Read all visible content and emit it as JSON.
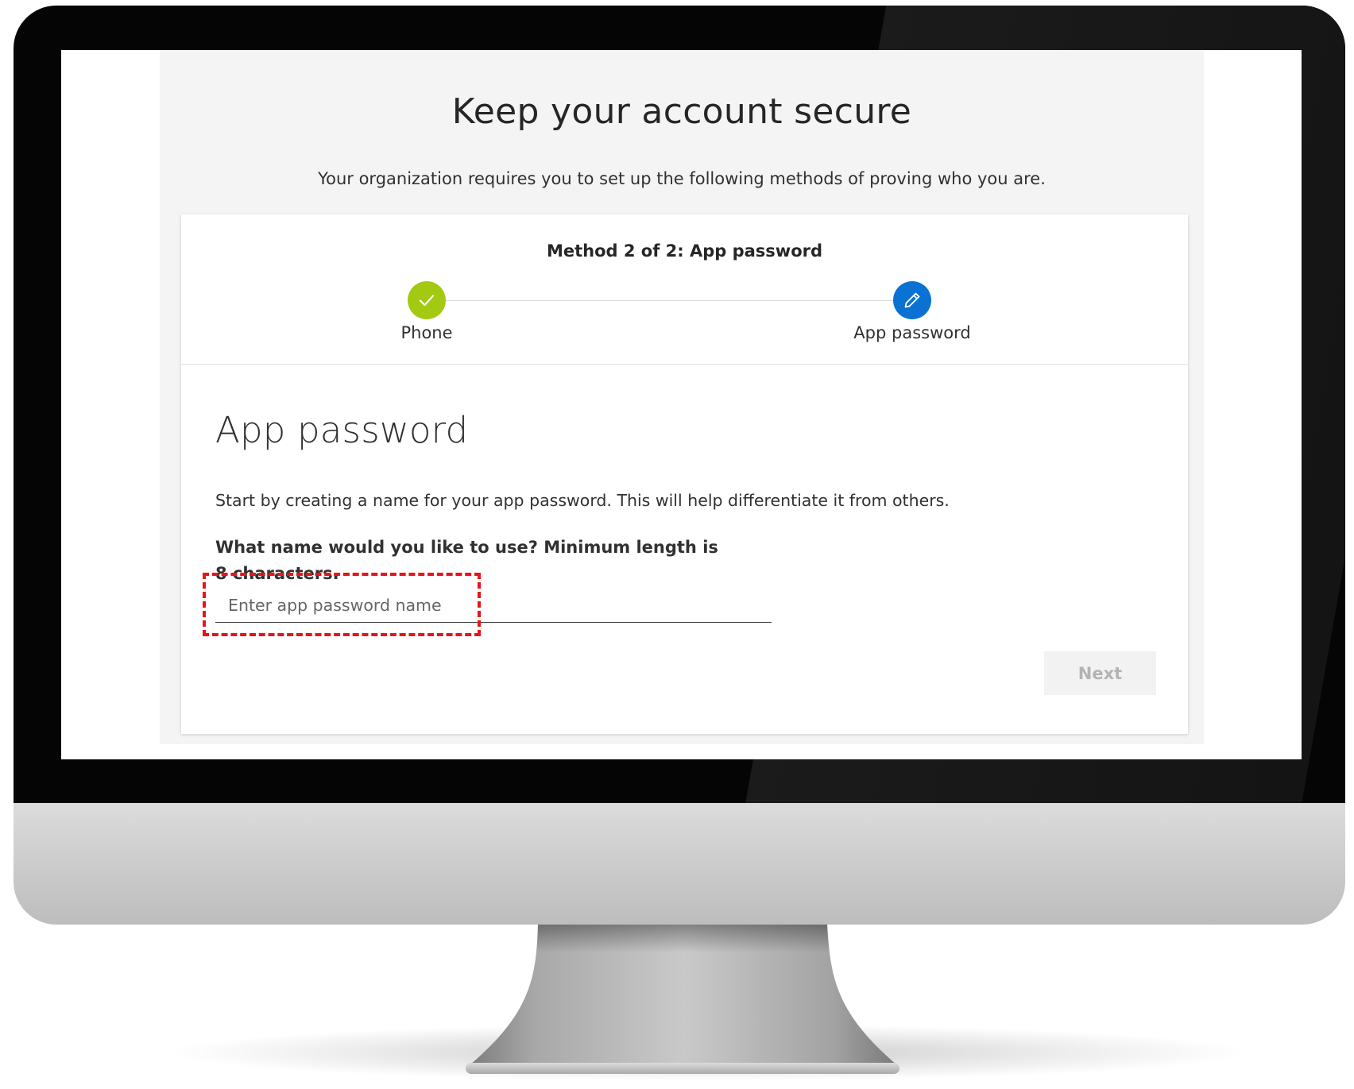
{
  "page": {
    "title": "Keep your account secure",
    "subtitle": "Your organization requires you to set up the following methods of proving who you are."
  },
  "wizard": {
    "method_heading": "Method 2 of 2: App password",
    "steps": [
      {
        "label": "Phone",
        "state": "completed",
        "icon": "checkmark-icon",
        "color": "#a4c912"
      },
      {
        "label": "App password",
        "state": "current",
        "icon": "pencil-icon",
        "color": "#0b72d4"
      }
    ]
  },
  "form": {
    "section_title": "App password",
    "description": "Start by creating a name for your app password. This will help differentiate it from others.",
    "field_label": "What name would you like to use? Minimum length is 8 characters.",
    "input_value": "",
    "input_placeholder": "Enter app password name",
    "next_label": "Next",
    "next_enabled": false
  },
  "colors": {
    "highlight": "#e8141b",
    "accent": "#0b72d4",
    "success": "#a4c912"
  }
}
